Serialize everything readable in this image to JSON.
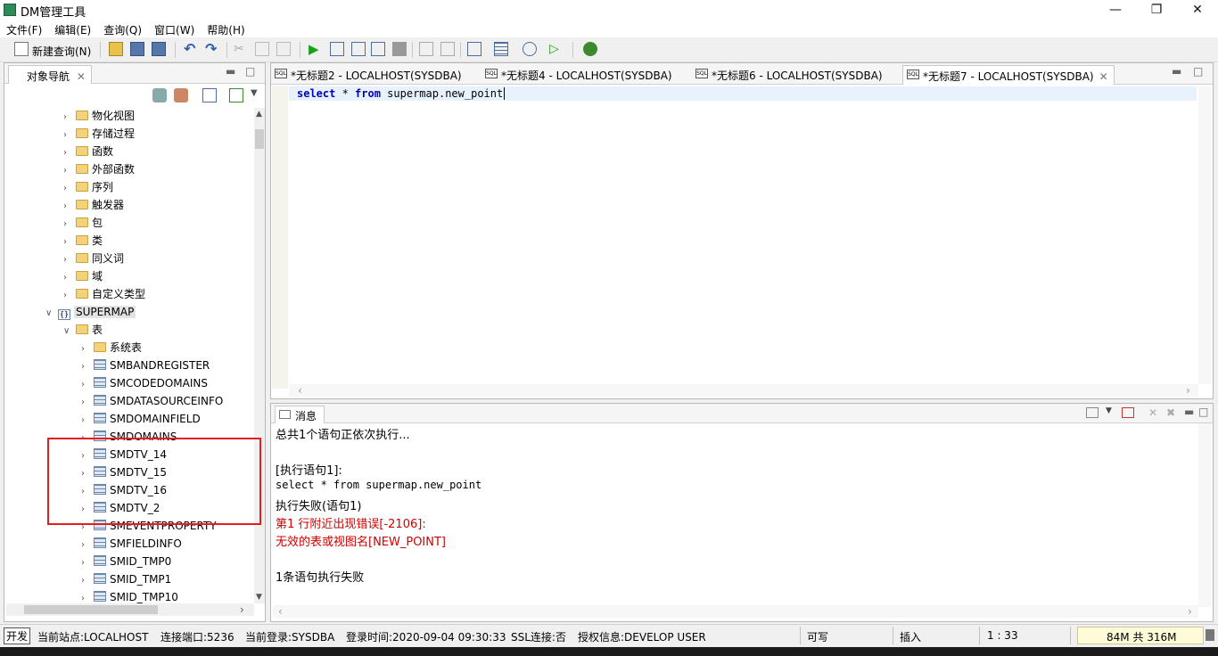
{
  "window": {
    "title": "DM管理工具"
  },
  "menu": [
    "文件(F)",
    "编辑(E)",
    "查询(Q)",
    "窗口(W)",
    "帮助(H)"
  ],
  "toolbar": {
    "new_query": "新建查询(N)"
  },
  "nav": {
    "tab": "对象导航",
    "tree": [
      {
        "label": "物化视图",
        "icon": "folder-icon",
        "level": 1,
        "expanded": false
      },
      {
        "label": "存储过程",
        "icon": "folder-icon",
        "level": 1,
        "expanded": false
      },
      {
        "label": "函数",
        "icon": "folder-icon",
        "level": 1,
        "expanded": false
      },
      {
        "label": "外部函数",
        "icon": "folder-icon",
        "level": 1,
        "expanded": false
      },
      {
        "label": "序列",
        "icon": "folder-icon",
        "level": 1,
        "expanded": false
      },
      {
        "label": "触发器",
        "icon": "folder-icon",
        "level": 1,
        "expanded": false
      },
      {
        "label": "包",
        "icon": "folder-icon",
        "level": 1,
        "expanded": false
      },
      {
        "label": "类",
        "icon": "folder-icon",
        "level": 1,
        "expanded": false
      },
      {
        "label": "同义词",
        "icon": "folder-icon",
        "level": 1,
        "expanded": false
      },
      {
        "label": "域",
        "icon": "folder-icon",
        "level": 1,
        "expanded": false
      },
      {
        "label": "自定义类型",
        "icon": "folder-icon",
        "level": 1,
        "expanded": false
      },
      {
        "label": "SUPERMAP",
        "icon": "schema-icon",
        "level": 0,
        "expanded": true
      },
      {
        "label": "表",
        "icon": "folder-icon",
        "level": 1,
        "expanded": true
      },
      {
        "label": "系统表",
        "icon": "folder-icon",
        "level": 2,
        "expanded": false
      },
      {
        "label": "SMBANDREGISTER",
        "icon": "table-icon",
        "level": 2,
        "expanded": false
      },
      {
        "label": "SMCODEDOMAINS",
        "icon": "table-icon",
        "level": 2,
        "expanded": false
      },
      {
        "label": "SMDATASOURCEINFO",
        "icon": "table-icon",
        "level": 2,
        "expanded": false
      },
      {
        "label": "SMDOMAINFIELD",
        "icon": "table-icon",
        "level": 2,
        "expanded": false
      },
      {
        "label": "SMDOMAINS",
        "icon": "table-icon",
        "level": 2,
        "expanded": false
      },
      {
        "label": "SMDTV_14",
        "icon": "table-icon",
        "level": 2,
        "expanded": false
      },
      {
        "label": "SMDTV_15",
        "icon": "table-icon",
        "level": 2,
        "expanded": false
      },
      {
        "label": "SMDTV_16",
        "icon": "table-icon",
        "level": 2,
        "expanded": false
      },
      {
        "label": "SMDTV_2",
        "icon": "table-icon",
        "level": 2,
        "expanded": false
      },
      {
        "label": "SMEVENTPROPERTY",
        "icon": "table-icon",
        "level": 2,
        "expanded": false
      },
      {
        "label": "SMFIELDINFO",
        "icon": "table-icon",
        "level": 2,
        "expanded": false
      },
      {
        "label": "SMID_TMP0",
        "icon": "table-icon",
        "level": 2,
        "expanded": false
      },
      {
        "label": "SMID_TMP1",
        "icon": "table-icon",
        "level": 2,
        "expanded": false
      },
      {
        "label": "SMID_TMP10",
        "icon": "table-icon",
        "level": 2,
        "expanded": false
      }
    ]
  },
  "editor": {
    "tabs": [
      "*无标题2 - LOCALHOST(SYSDBA)",
      "*无标题4 - LOCALHOST(SYSDBA)",
      "*无标题6 - LOCALHOST(SYSDBA)",
      "*无标题7 - LOCALHOST(SYSDBA)"
    ],
    "sql_kw1": "select",
    "sql_star": " * ",
    "sql_kw2": "from",
    "sql_rest": " supermap.new_point"
  },
  "messages": {
    "tab": "消息",
    "lines": [
      {
        "text": "总共1个语句正依次执行...",
        "style": "normal"
      },
      {
        "text": "",
        "style": "normal"
      },
      {
        "text": "[执行语句1]:",
        "style": "normal"
      },
      {
        "text": "select * from supermap.new_point",
        "style": "mono"
      },
      {
        "text": "执行失败(语句1)",
        "style": "normal"
      },
      {
        "text": "第1 行附近出现错误[-2106]:",
        "style": "red"
      },
      {
        "text": "无效的表或视图名[NEW_POINT]",
        "style": "red"
      },
      {
        "text": "",
        "style": "normal"
      },
      {
        "text": "1条语句执行失败",
        "style": "normal"
      }
    ]
  },
  "status": {
    "mode": "开发",
    "site": "当前站点:LOCALHOST",
    "port": "连接端口:5236",
    "login": "当前登录:SYSDBA",
    "login_time": "登录时间:2020-09-04 09:30:33",
    "ssl": "SSL连接:否",
    "license": "授权信息:DEVELOP USER",
    "writable": "可写",
    "insert": "插入",
    "cursor": "1 : 33",
    "memory": "84M 共 316M"
  }
}
